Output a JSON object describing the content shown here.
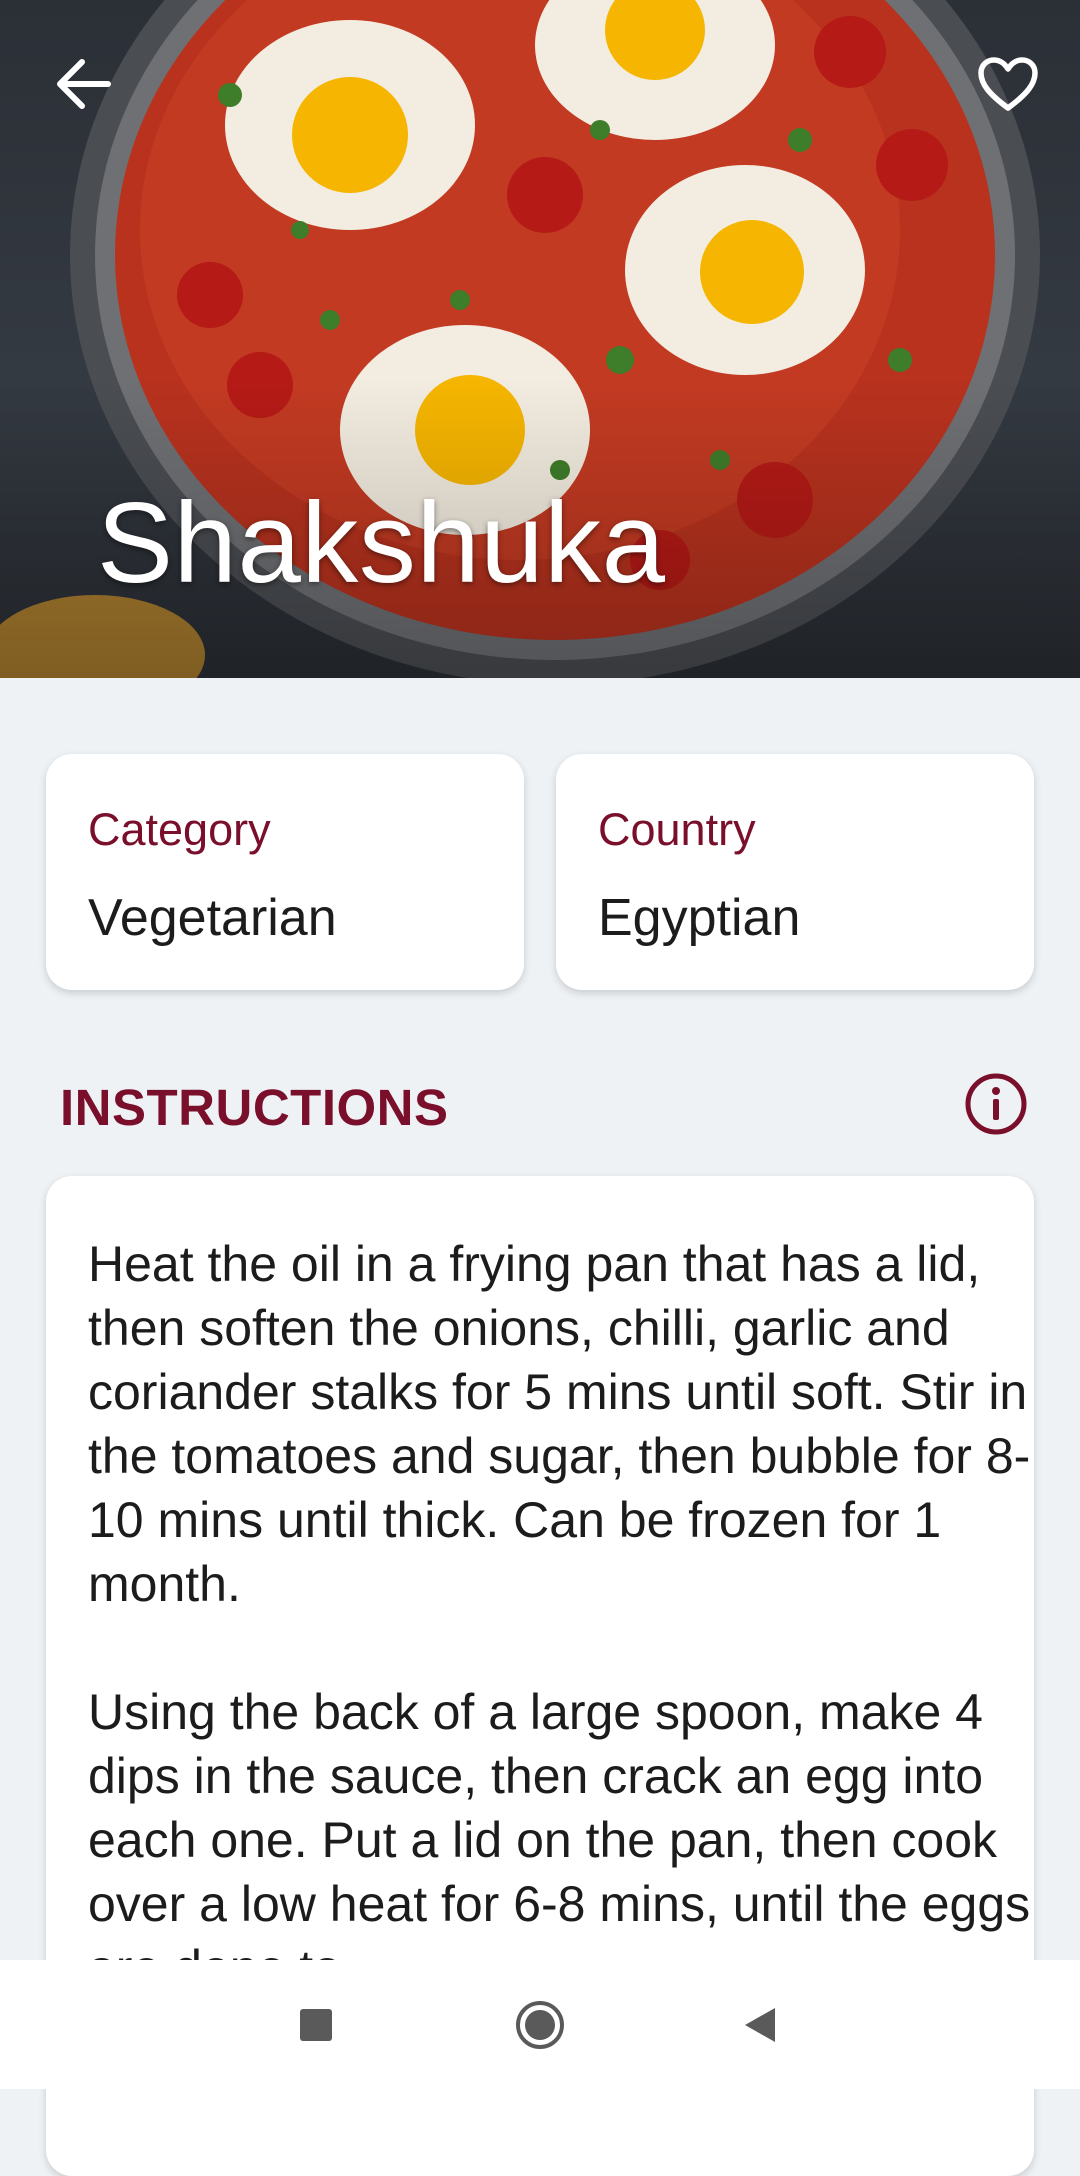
{
  "hero": {
    "title": "Shakshuka",
    "back_icon": "arrow-left-icon",
    "favorite_icon": "heart-outline-icon"
  },
  "info": {
    "category_label": "Category",
    "category_value": "Vegetarian",
    "country_label": "Country",
    "country_value": "Egyptian"
  },
  "instructions": {
    "title": "INSTRUCTIONS",
    "info_icon": "info-circle-icon",
    "paragraphs": [
      "Heat the oil in a frying pan that has a lid, then soften the onions, chilli, garlic and coriander stalks for 5 mins until soft. Stir in the tomatoes and sugar, then bubble for 8-10 mins until thick. Can be frozen for 1 month.",
      "Using the back of a large spoon, make 4 dips in the sauce, then crack an egg into each one. Put a lid on the pan, then cook over a low heat for 6-8 mins, until the eggs are done to"
    ]
  },
  "navbar": {
    "recents_icon": "square-icon",
    "home_icon": "circle-icon",
    "back_icon": "triangle-back-icon"
  },
  "colors": {
    "accent": "#7a0f2c",
    "background": "#eef2f5",
    "card": "#ffffff",
    "text": "#1c1c1c"
  }
}
